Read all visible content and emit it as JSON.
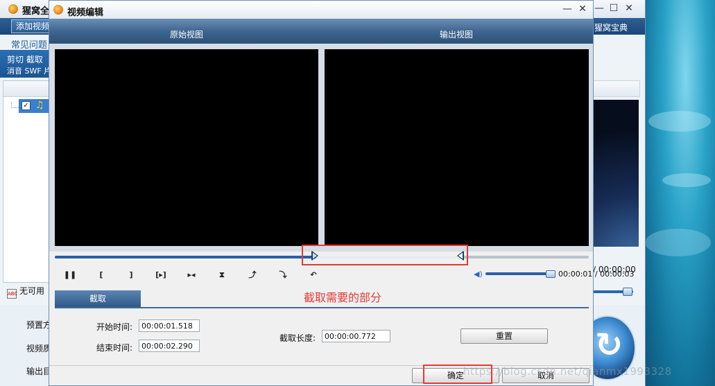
{
  "background_app": {
    "title": "猩窝全",
    "add_video_label": "添加视频",
    "classic_label": "猩窝宝典",
    "faq_label": "常见问题",
    "menu_row1": "剪切 截取",
    "menu_row2": "消音 SWF 片",
    "unavailable_label": "无可用",
    "preset_label": "预置方",
    "video_label": "视频质",
    "output_label": "输出目",
    "time_readout": "/ 00:00:00"
  },
  "dialog": {
    "title": "视频编辑",
    "original_view_label": "原始视图",
    "output_view_label": "输出视图",
    "time_display": "00:00:01 / 00:00:03",
    "playback_position": 0.49,
    "clip_range": [
      0.49,
      0.76
    ],
    "volume_level": 0.92,
    "tab_label": "截取",
    "annotation": "截取需要的部分",
    "start_time_label": "开始时间:",
    "start_time_value": "00:00:01.518",
    "end_time_label": "结束时间:",
    "end_time_value": "00:00:02.290",
    "length_label": "截取长度:",
    "length_value": "00:00:00.772",
    "reset_label": "重置",
    "ok_label": "确定",
    "cancel_label": "取消",
    "watermark": "https://blog.csdn.net/qianmx1993328"
  },
  "colors": {
    "accent": "#2a5ea8",
    "highlight_red": "#e53935",
    "header_blue": "#3f6690"
  }
}
